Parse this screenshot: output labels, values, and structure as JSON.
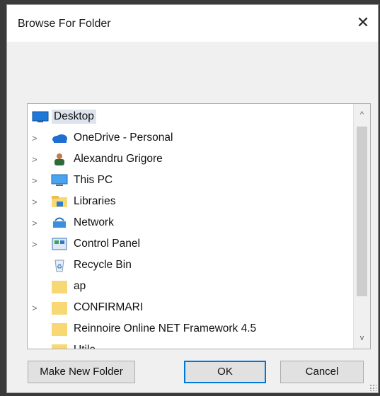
{
  "dialog": {
    "title": "Browse For Folder",
    "close_label": "✕"
  },
  "tree": {
    "items": [
      {
        "label": "Desktop",
        "icon": "desktop-icon"
      },
      {
        "label": "OneDrive - Personal",
        "icon": "onedrive-cloud-icon"
      },
      {
        "label": "Alexandru Grigore",
        "icon": "user-folder-icon"
      },
      {
        "label": "This PC",
        "icon": "this-pc-icon"
      },
      {
        "label": "Libraries",
        "icon": "libraries-icon"
      },
      {
        "label": "Network",
        "icon": "network-icon"
      },
      {
        "label": "Control Panel",
        "icon": "control-panel-icon"
      },
      {
        "label": "Recycle Bin",
        "icon": "recycle-bin-icon"
      },
      {
        "label": "ap",
        "icon": "folder-icon"
      },
      {
        "label": "CONFIRMARI",
        "icon": "folder-icon"
      },
      {
        "label": "Reinnoire Online NET Framework 4.5",
        "icon": "folder-icon"
      },
      {
        "label": "Utile",
        "icon": "folder-icon"
      }
    ],
    "expander_glyph": ">",
    "scroll_up_glyph": "^",
    "scroll_down_glyph": "v"
  },
  "buttons": {
    "make_new_folder": "Make New Folder",
    "ok": "OK",
    "cancel": "Cancel"
  },
  "colors": {
    "accent": "#0078d7",
    "selection": "#dde4ee",
    "folder": "#f8d775",
    "onedrive": "#1f6fd1"
  }
}
